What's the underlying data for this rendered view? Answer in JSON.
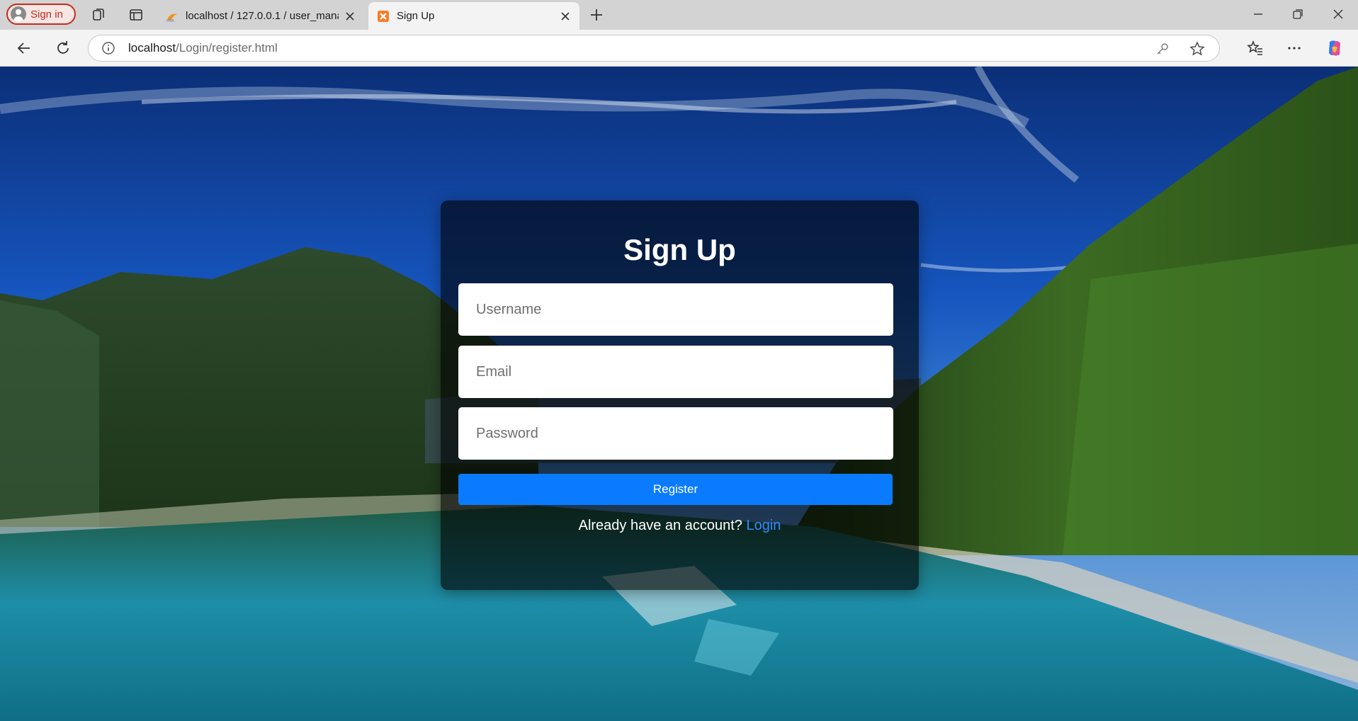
{
  "browser": {
    "profile_label": "Sign in",
    "tabs": [
      {
        "title": "localhost / 127.0.0.1 / user_manag",
        "favicon": "phpmyadmin-icon",
        "active": false
      },
      {
        "title": "Sign Up",
        "favicon": "xampp-icon",
        "active": true
      }
    ],
    "url_host": "localhost",
    "url_path": "/Login/register.html"
  },
  "page": {
    "title": "Sign Up",
    "fields": {
      "username_placeholder": "Username",
      "email_placeholder": "Email",
      "password_placeholder": "Password"
    },
    "register_label": "Register",
    "account_prompt": "Already have an account?",
    "login_link": "Login"
  },
  "colors": {
    "accent": "#0a7bff",
    "link": "#2f8cff",
    "profile": "#c42b1c"
  }
}
